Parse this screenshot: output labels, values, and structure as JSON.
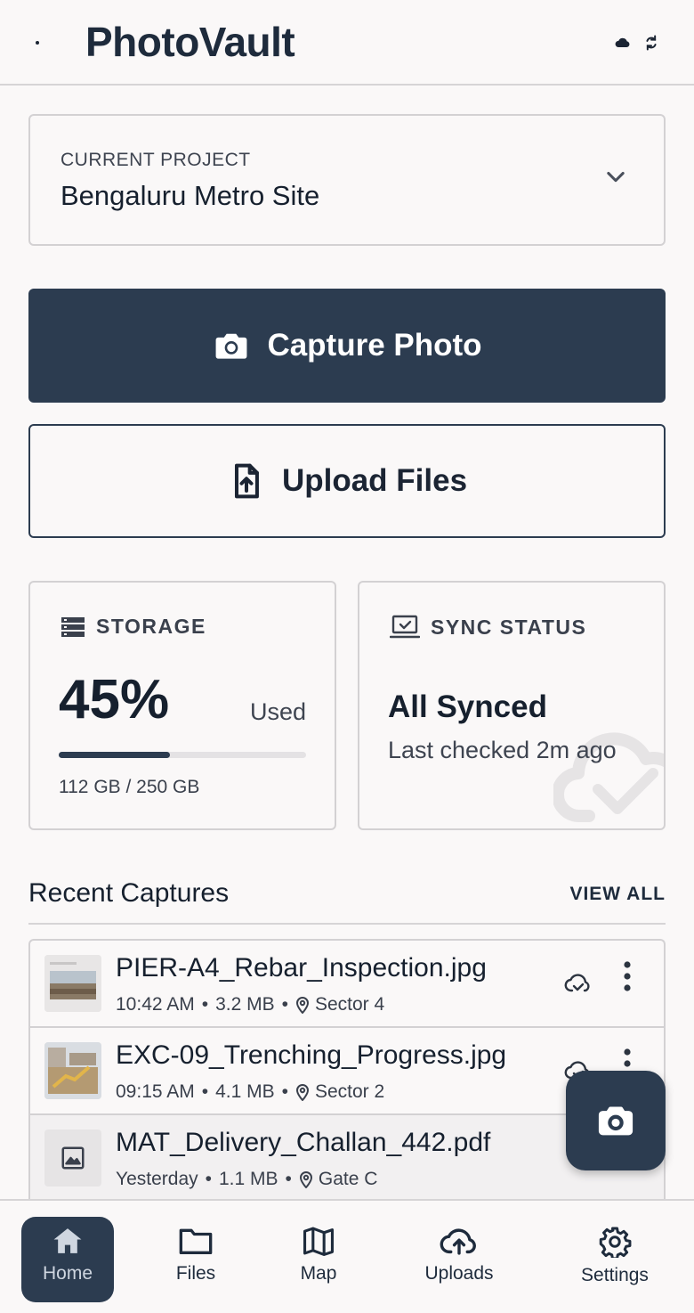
{
  "header": {
    "title": "PhotoVault",
    "icons": [
      "menu-dot",
      "cloud-icon",
      "sync-icon"
    ]
  },
  "project": {
    "label": "CURRENT PROJECT",
    "name": "Bengaluru Metro Site"
  },
  "actions": {
    "capture_label": "Capture Photo",
    "upload_label": "Upload Files"
  },
  "storage": {
    "heading": "STORAGE",
    "percent": "45%",
    "percent_value": 45,
    "used_label": "Used",
    "detail": "112 GB / 250 GB"
  },
  "sync": {
    "heading": "SYNC STATUS",
    "status": "All Synced",
    "detail": "Last checked 2m ago"
  },
  "recent": {
    "title": "Recent Captures",
    "view_all": "VIEW ALL",
    "items": [
      {
        "name": "PIER-A4_Rebar_Inspection.jpg",
        "time": "10:42 AM",
        "size": "3.2 MB",
        "location": "Sector 4"
      },
      {
        "name": "EXC-09_Trenching_Progress.jpg",
        "time": "09:15 AM",
        "size": "4.1 MB",
        "location": "Sector 2"
      },
      {
        "name": "MAT_Delivery_Challan_442.pdf",
        "time": "Yesterday",
        "size": "1.1 MB",
        "location": "Gate C"
      }
    ]
  },
  "nav": {
    "items": [
      {
        "label": "Home",
        "icon": "home-icon",
        "active": true
      },
      {
        "label": "Files",
        "icon": "folder-icon"
      },
      {
        "label": "Map",
        "icon": "map-icon"
      },
      {
        "label": "Uploads",
        "icon": "cloud-upload-icon"
      },
      {
        "label": "Settings",
        "icon": "gear-icon"
      }
    ]
  },
  "colors": {
    "primary": "#2c3c50",
    "background": "#faf8f8",
    "text": "#16202e",
    "border": "#d3d1d3"
  }
}
